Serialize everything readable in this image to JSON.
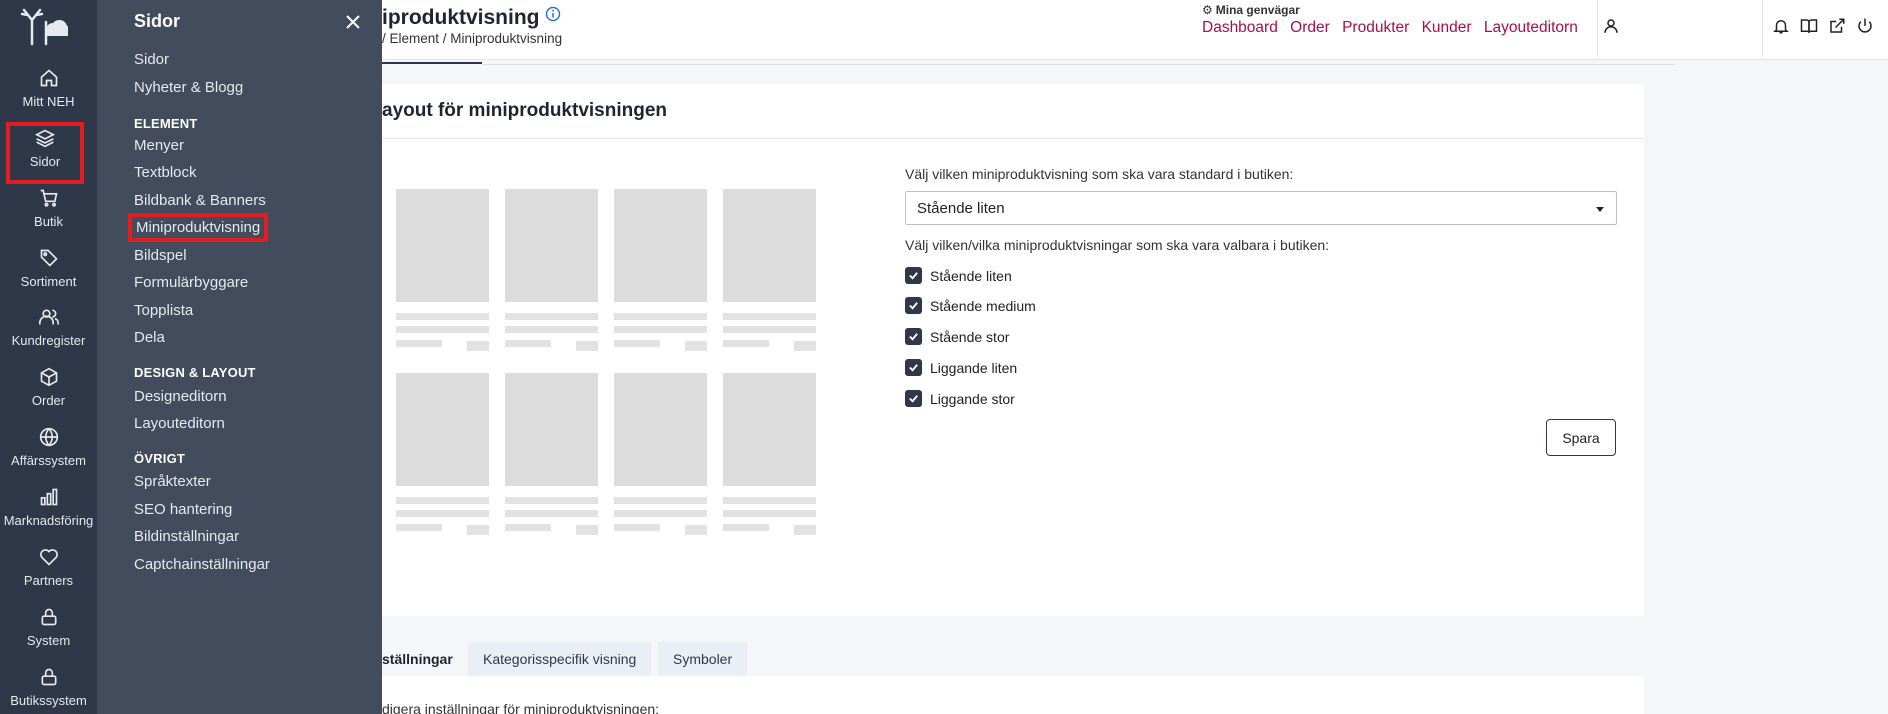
{
  "rail": {
    "items": [
      {
        "label": "Mitt NEH",
        "icon": "home-icon"
      },
      {
        "label": "Sidor",
        "icon": "layers-icon"
      },
      {
        "label": "Butik",
        "icon": "cart-icon"
      },
      {
        "label": "Sortiment",
        "icon": "tag-icon"
      },
      {
        "label": "Kundregister",
        "icon": "users-icon"
      },
      {
        "label": "Order",
        "icon": "box-icon"
      },
      {
        "label": "Affärssystem",
        "icon": "globe-icon"
      },
      {
        "label": "Marknadsföring",
        "icon": "bar-chart-icon"
      },
      {
        "label": "Partners",
        "icon": "heart-icon"
      },
      {
        "label": "System",
        "icon": "lock-icon"
      },
      {
        "label": "Butikssystem",
        "icon": "lock-icon"
      }
    ]
  },
  "submenu": {
    "title": "Sidor",
    "top_links": [
      "Sidor",
      "Nyheter & Blogg"
    ],
    "element_heading": "ELEMENT",
    "element_links": [
      "Menyer",
      "Textblock",
      "Bildbank & Banners",
      "Miniproduktvisning",
      "Bildspel",
      "Formulärbyggare",
      "Topplista",
      "Dela"
    ],
    "design_heading": "DESIGN & LAYOUT",
    "design_links": [
      "Designeditorn",
      "Layouteditorn"
    ],
    "other_heading": "ÖVRIGT",
    "other_links": [
      "Språktexter",
      "SEO hantering",
      "Bildinställningar",
      "Captchainställningar"
    ]
  },
  "header": {
    "title": "iproduktvisning",
    "breadcrumb": "/ Element / Miniproduktvisning",
    "shortcuts_title": "Mina genvägar",
    "shortcuts": [
      "Dashboard",
      "Order",
      "Produkter",
      "Kunder",
      "Layouteditorn"
    ]
  },
  "card": {
    "title": "ayout för miniproduktvisningen",
    "default_label": "Välj vilken miniproduktvisning som ska vara standard i butiken:",
    "default_value": "Stående liten",
    "options_label": "Välj vilken/vilka miniproduktvisningar som ska vara valbara i butiken:",
    "options": [
      {
        "label": "Stående liten",
        "checked": true
      },
      {
        "label": "Stående medium",
        "checked": true
      },
      {
        "label": "Stående stor",
        "checked": true
      },
      {
        "label": "Liggande liten",
        "checked": true
      },
      {
        "label": "Liggande stor",
        "checked": true
      }
    ],
    "save_label": "Spara"
  },
  "tabs": [
    "ställningar",
    "Kategorisspecifik visning",
    "Symboler"
  ],
  "bottom_text": "digera inställningar för miniproduktvisningen:",
  "colors": {
    "rail_bg": "#2f3848",
    "submenu_bg": "#424c5c",
    "accent": "#a0124e",
    "highlight": "#e11d22"
  }
}
